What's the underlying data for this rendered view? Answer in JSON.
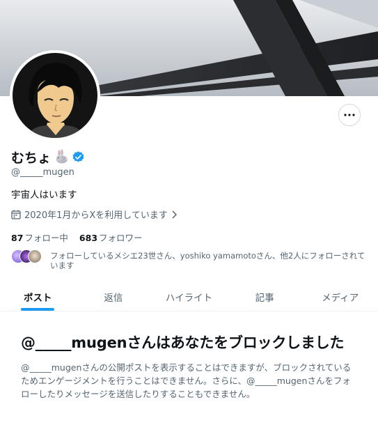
{
  "profile": {
    "display_name": "むちょ",
    "handle": "@_____mugen",
    "bio": "宇宙人はいます",
    "joined": "2020年1月からXを利用しています"
  },
  "stats": {
    "following_count": "87",
    "following_label": "フォロー中",
    "followers_count": "683",
    "followers_label": "フォロワー"
  },
  "followers_you_know": "フォローしているメシエ23世さん、yoshiko yamamotoさん、他2人にフォローされています",
  "tabs": [
    {
      "label": "ポスト",
      "active": true
    },
    {
      "label": "返信",
      "active": false
    },
    {
      "label": "ハイライト",
      "active": false
    },
    {
      "label": "記事",
      "active": false
    },
    {
      "label": "メディア",
      "active": false
    }
  ],
  "blocked": {
    "title": "@_____mugenさんはあなたをブロックしました",
    "description": "@_____mugenさんの公開ポストを表示することはできますが、ブロックされているためエンゲージメントを行うことはできません。さらに、@_____mugenさんをフォローしたりメッセージを送信したりすることもできません。"
  },
  "icons": {
    "more": "more-horizontal-icon",
    "verified": "verified-badge-icon",
    "calendar": "calendar-icon",
    "chevron": "chevron-right-icon",
    "rabbit": "rabbit-emoji-icon"
  },
  "colors": {
    "accent": "#1d9bf0",
    "text_primary": "#0f1419",
    "text_secondary": "#536471",
    "border": "#cfd9de"
  }
}
